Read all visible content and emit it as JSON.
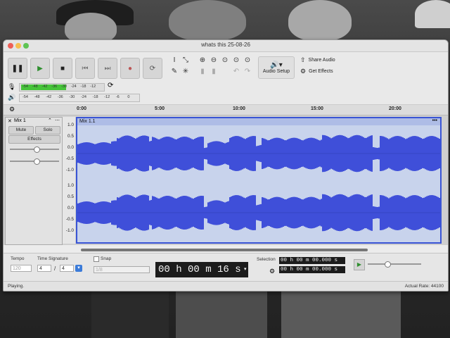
{
  "window": {
    "title": "whats this 25-08-26"
  },
  "toolbar": {
    "pause_icon": "pause-icon",
    "play_icon": "play-icon",
    "stop_icon": "stop-icon",
    "skip_start_icon": "skip-start-icon",
    "skip_end_icon": "skip-end-icon",
    "record_icon": "record-icon",
    "loop_icon": "loop-icon",
    "audio_setup_label": "Audio Setup",
    "share_audio_label": "Share Audio",
    "get_effects_label": "Get Effects"
  },
  "meters": {
    "record_labels": [
      "-54",
      "-48",
      "-42",
      "-36",
      "-30",
      "-24",
      "-18",
      "-12"
    ],
    "playback_labels": [
      "-54",
      "-48",
      "-42",
      "-36",
      "-30",
      "-24",
      "-18",
      "-12",
      "-6",
      "0"
    ],
    "record_level": 0.55,
    "colors": {
      "level": "#46c43a"
    }
  },
  "ruler": {
    "labels": [
      "0:00",
      "5:00",
      "10:00",
      "15:00",
      "20:00"
    ]
  },
  "track": {
    "name": "Mix 1",
    "mute_label": "Mute",
    "solo_label": "Solo",
    "effects_label": "Effects",
    "clip_name": "Mix 1.1",
    "clip_menu": "•••",
    "scale_upper": [
      "1.0",
      "0.5",
      "0.0",
      "-0.5",
      "-1.0"
    ],
    "scale_lower": [
      "1.0",
      "0.5",
      "0.0",
      "-0.5",
      "-1.0"
    ],
    "colors": {
      "wave": "#3f4fd9",
      "clip_bg": "#c8d3ec",
      "border": "#3a55d5"
    }
  },
  "bottom": {
    "tempo_label": "Tempo",
    "tempo_value": "120",
    "time_signature_label": "Time Signature",
    "ts_numerator": "4",
    "ts_slash": "/",
    "ts_denominator": "4",
    "snap_label": "Snap",
    "snap_value": "1/8",
    "time_display": "00 h 00 m 16 s",
    "selection_label": "Selection",
    "selection_start": "00 h 00 m 00.000 s",
    "selection_end": "00 h 00 m 00.000 s"
  },
  "status": {
    "left": "Playing.",
    "right": "Actual Rate: 44100"
  }
}
